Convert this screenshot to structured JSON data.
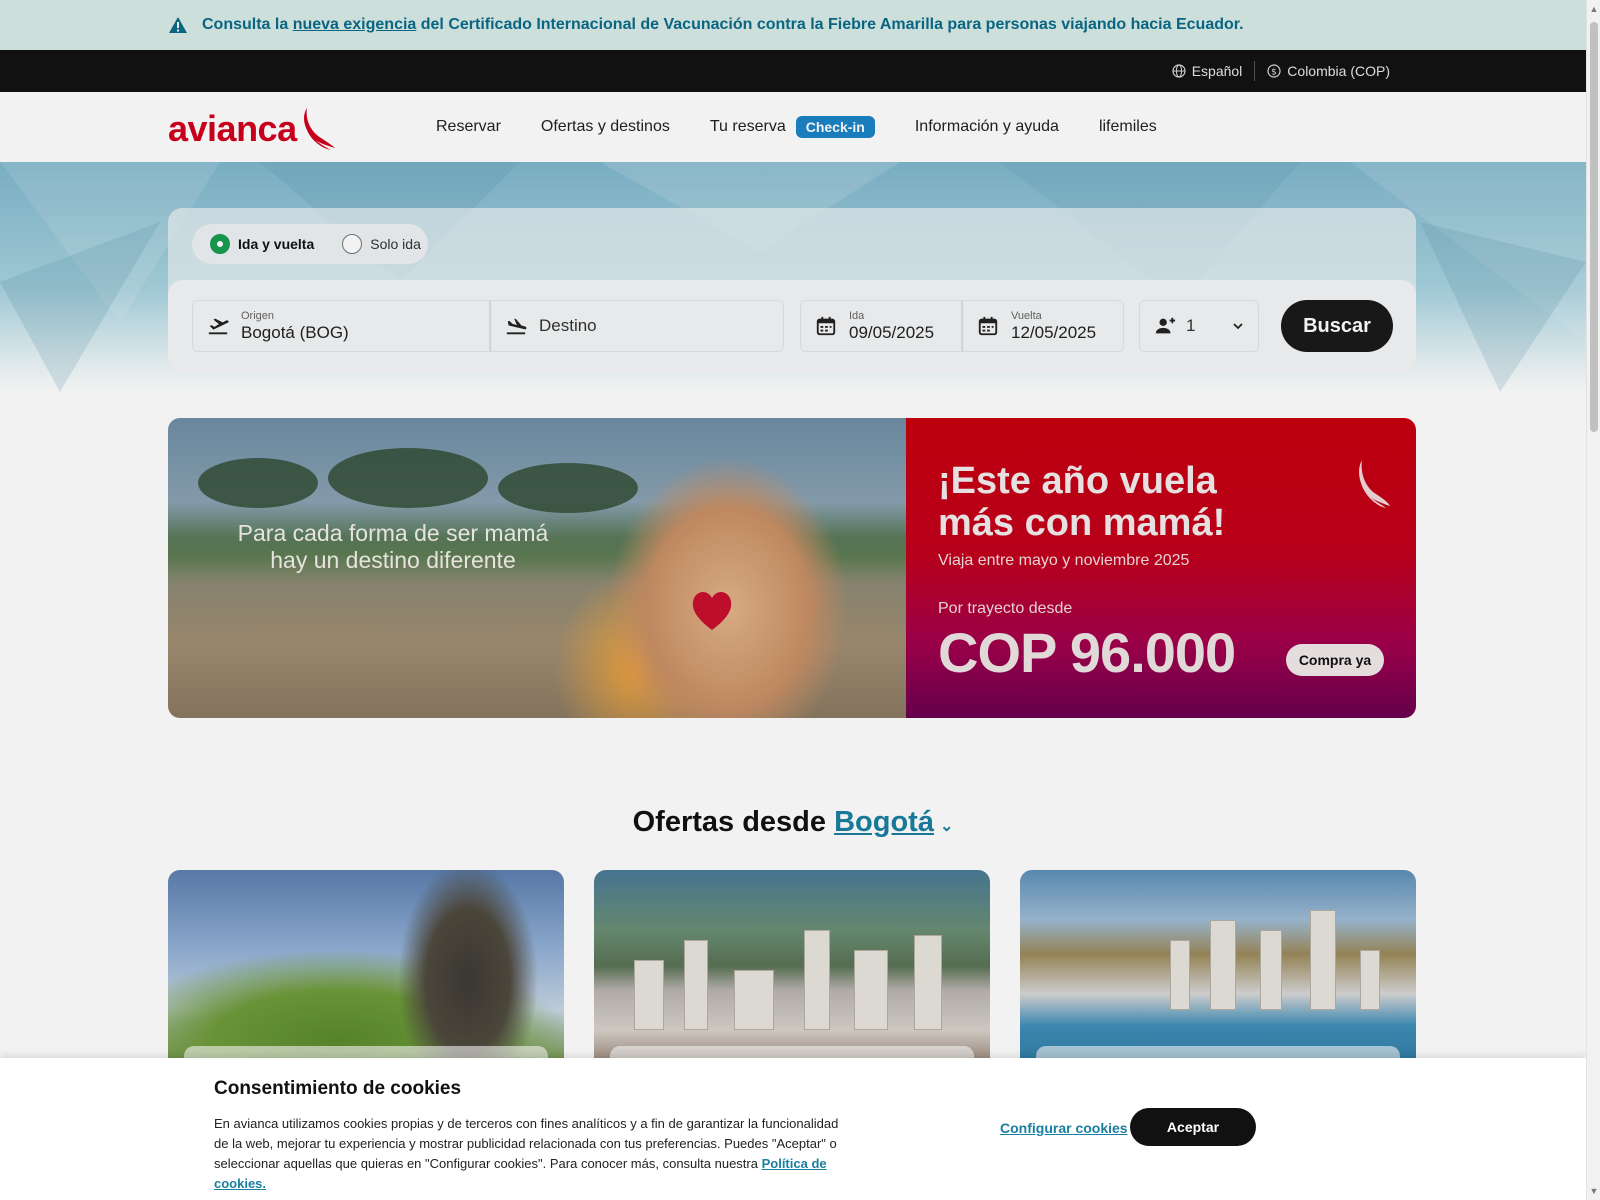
{
  "alert": {
    "prefix": "Consulta la ",
    "link": "nueva exigencia",
    "suffix": " del Certificado Internacional de Vacunación contra la Fiebre Amarilla para personas viajando hacia Ecuador."
  },
  "utility": {
    "language": "Español",
    "country": "Colombia (COP)"
  },
  "nav": {
    "logo": "avianca",
    "items": [
      "Reservar",
      "Ofertas y destinos",
      "Tu reserva",
      "Información y ayuda",
      "lifemiles"
    ],
    "checkin": "Check-in"
  },
  "search": {
    "trip_round": "Ida y vuelta",
    "trip_one": "Solo ida",
    "origin_label": "Origen",
    "origin_value": "Bogotá  (BOG)",
    "destination_placeholder": "Destino",
    "depart_label": "Ida",
    "depart_value": "09/05/2025",
    "return_label": "Vuelta",
    "return_value": "12/05/2025",
    "passengers": "1",
    "button": "Buscar"
  },
  "promo": {
    "caption_line1": "Para cada forma de ser mamá",
    "caption_line2": "hay un destino diferente",
    "headline_line1": "¡Este año vuela",
    "headline_line2": "más con mamá!",
    "subtitle": "Viaja entre mayo y noviembre 2025",
    "from_label": "Por trayecto desde",
    "price": "COP 96.000",
    "cta": "Compra ya"
  },
  "offers": {
    "title": "Ofertas desde",
    "city": "Bogotá"
  },
  "cookies": {
    "title": "Consentimiento de cookies",
    "text": "En avianca utilizamos cookies propias y de terceros con fines analíticos y a fin de garantizar la funcionalidad de la web, mejorar tu experiencia y mostrar publicidad relacionada con tus preferencias. Puedes \"Aceptar\" o seleccionar aquellas que quieras en \"Configurar cookies\". Para conocer más, consulta nuestra ",
    "policy_link": "Política de cookies.",
    "configure": "Configurar cookies",
    "accept": "Aceptar"
  },
  "colors": {
    "brand_red": "#d1001c",
    "accent_teal": "#1a7fa0",
    "checkin_blue": "#1b84c7"
  }
}
